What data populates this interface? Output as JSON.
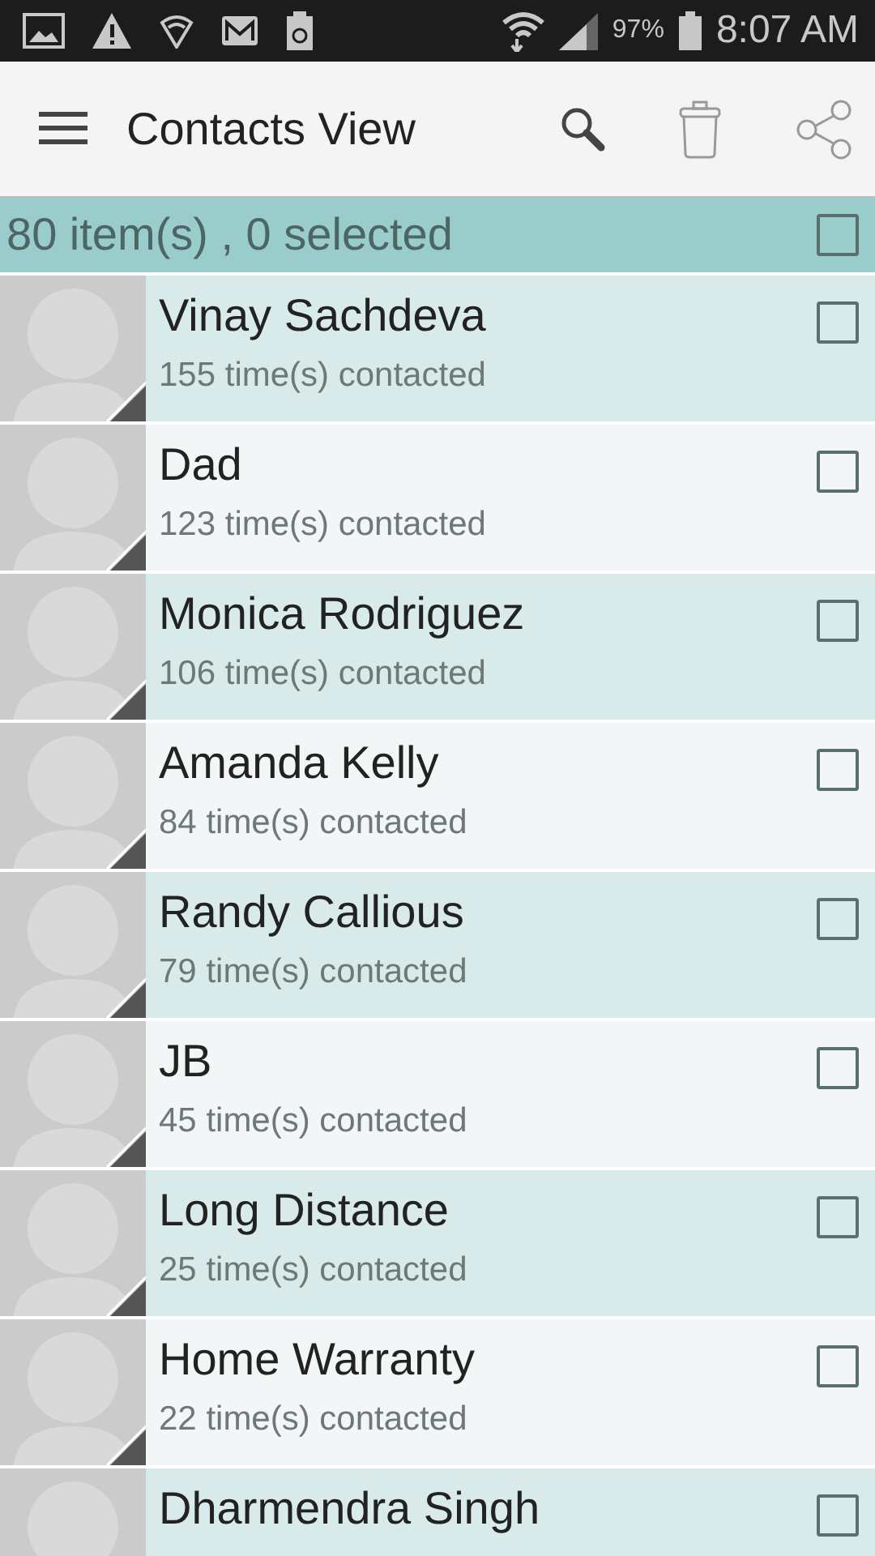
{
  "status_bar": {
    "battery": "97%",
    "time": "8:07 AM"
  },
  "toolbar": {
    "title": "Contacts View"
  },
  "summary": {
    "text": "80 item(s) , 0 selected",
    "checked": false
  },
  "contacts": [
    {
      "name": "Vinay Sachdeva",
      "count": "155 time(s) contacted",
      "checked": false
    },
    {
      "name": "Dad",
      "count": "123 time(s) contacted",
      "checked": false
    },
    {
      "name": "Monica Rodriguez",
      "count": "106 time(s) contacted",
      "checked": false
    },
    {
      "name": "Amanda Kelly",
      "count": "84 time(s) contacted",
      "checked": false
    },
    {
      "name": "Randy Callious",
      "count": "79 time(s) contacted",
      "checked": false
    },
    {
      "name": "JB",
      "count": "45 time(s) contacted",
      "checked": false
    },
    {
      "name": "Long Distance",
      "count": "25 time(s) contacted",
      "checked": false
    },
    {
      "name": "Home Warranty",
      "count": "22 time(s) contacted",
      "checked": false
    },
    {
      "name": "Dharmendra Singh",
      "checked": false
    }
  ]
}
